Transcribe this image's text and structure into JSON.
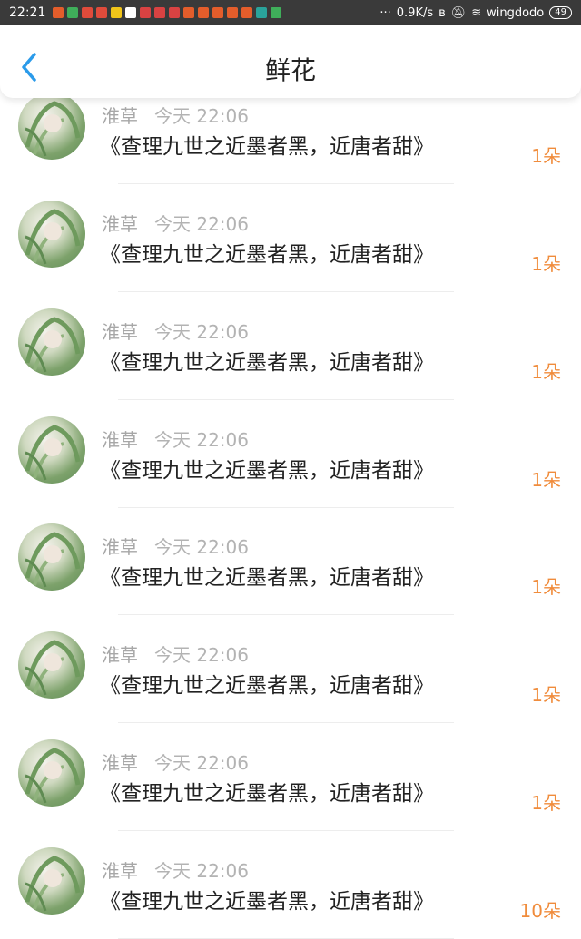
{
  "status_bar": {
    "time": "22:21",
    "net_speed": "0.9K/s",
    "wifi_name": "wingdodo",
    "battery": "49",
    "notification_colors": [
      "#e35d2b",
      "#3fae5a",
      "#e04b3b",
      "#e04b3b",
      "#f0c419",
      "#ffffff",
      "#d94242",
      "#d94242",
      "#d94242",
      "#e35d2b",
      "#e35d2b",
      "#e35d2b",
      "#e35d2b",
      "#e35d2b",
      "#2aa39b",
      "#3fae5a"
    ]
  },
  "header": {
    "title": "鲜花",
    "accent_color": "#2b9bea"
  },
  "rows": [
    {
      "user": "淮草",
      "time": "今天 22:06",
      "message": "《查理九世之近墨者黑，近唐者甜》",
      "count": "1朵"
    },
    {
      "user": "淮草",
      "time": "今天 22:06",
      "message": "《查理九世之近墨者黑，近唐者甜》",
      "count": "1朵"
    },
    {
      "user": "淮草",
      "time": "今天 22:06",
      "message": "《查理九世之近墨者黑，近唐者甜》",
      "count": "1朵"
    },
    {
      "user": "淮草",
      "time": "今天 22:06",
      "message": "《查理九世之近墨者黑，近唐者甜》",
      "count": "1朵"
    },
    {
      "user": "淮草",
      "time": "今天 22:06",
      "message": "《查理九世之近墨者黑，近唐者甜》",
      "count": "1朵"
    },
    {
      "user": "淮草",
      "time": "今天 22:06",
      "message": "《查理九世之近墨者黑，近唐者甜》",
      "count": "1朵"
    },
    {
      "user": "淮草",
      "time": "今天 22:06",
      "message": "《查理九世之近墨者黑，近唐者甜》",
      "count": "1朵"
    },
    {
      "user": "淮草",
      "time": "今天 22:06",
      "message": "《查理九世之近墨者黑，近唐者甜》",
      "count": "10朵"
    }
  ]
}
